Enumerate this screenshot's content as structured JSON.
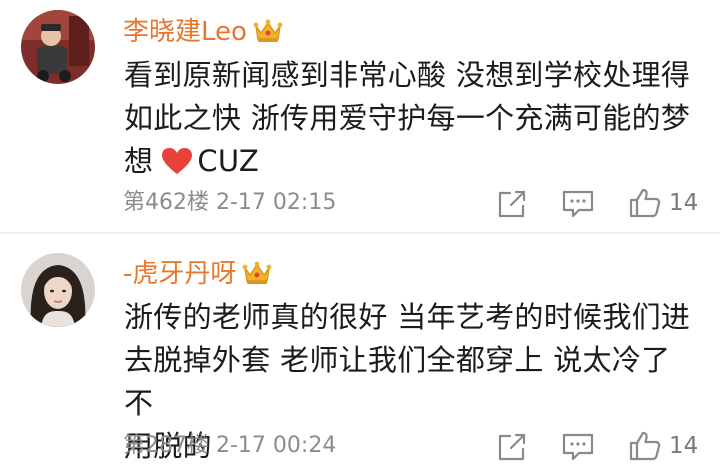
{
  "comments": [
    {
      "username": "李晓建Leo",
      "text_lines": [
        "看到原新闻感到非常心酸 没想到学校处理得",
        "如此之快 浙传用爱守护每一个充满可能的梦",
        "想"
      ],
      "text_suffix": "CUZ",
      "floor": "第462楼",
      "time": "2-17 02:15",
      "likes": "14"
    },
    {
      "username": "-虎牙丹呀",
      "text_lines": [
        "浙传的老师真的很好 当年艺考的时候我们进",
        "去脱掉外套 老师让我们全都穿上 说太冷了 不",
        "用脱的"
      ],
      "floor": "第287楼",
      "time": "2-17 00:24",
      "likes": "14"
    }
  ],
  "colors": {
    "username": "#e8772e",
    "crown": "#f0b429",
    "heart": "#e8413a",
    "meta": "#8c8c8c",
    "icon": "#8a8a8a"
  }
}
